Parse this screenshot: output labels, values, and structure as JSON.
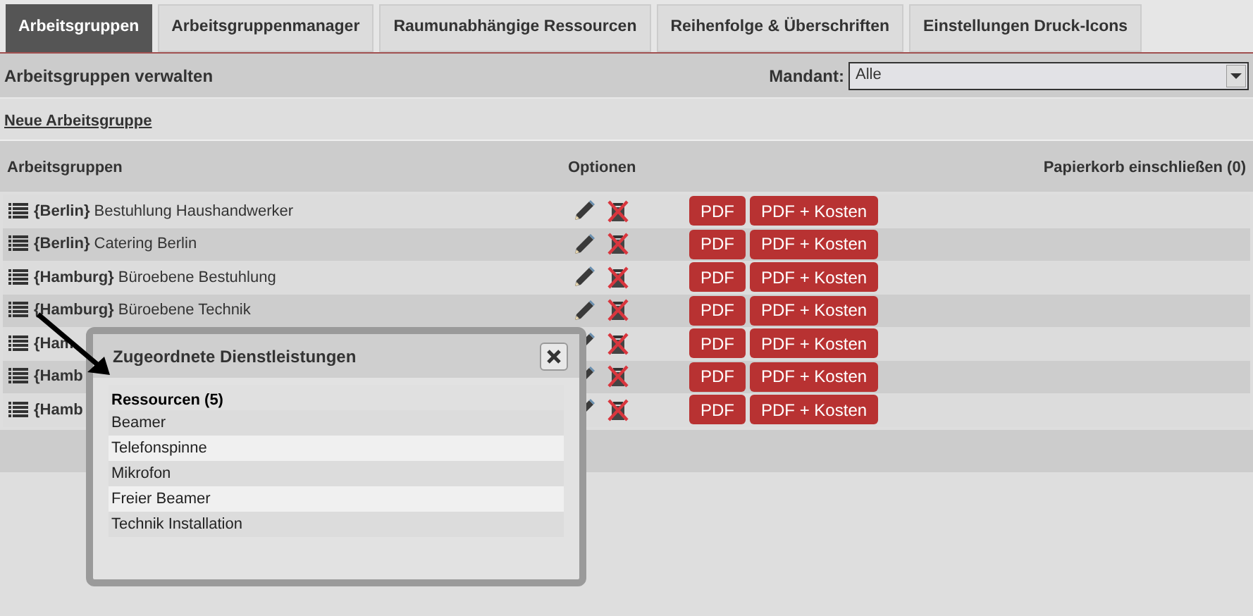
{
  "tabs": [
    {
      "label": "Arbeitsgruppen",
      "selected": true
    },
    {
      "label": "Arbeitsgruppenmanager",
      "selected": false
    },
    {
      "label": "Raumunabhängige Ressourcen",
      "selected": false
    },
    {
      "label": "Reihenfolge & Überschriften",
      "selected": false
    },
    {
      "label": "Einstellungen Druck-Icons",
      "selected": false
    }
  ],
  "section_title": "Arbeitsgruppen verwalten",
  "mandant": {
    "label": "Mandant:",
    "value": "Alle"
  },
  "new_link": "Neue Arbeitsgruppe",
  "table": {
    "columns": [
      "Arbeitsgruppen",
      "Optionen",
      "Papierkorb einschließen (0)"
    ],
    "rows": [
      {
        "location": "{Berlin}",
        "name": "Bestuhlung Haushandwerker",
        "pdf": "PDF",
        "pdf_costs": "PDF + Kosten"
      },
      {
        "location": "{Berlin}",
        "name": "Catering Berlin",
        "pdf": "PDF",
        "pdf_costs": "PDF + Kosten"
      },
      {
        "location": "{Hamburg}",
        "name": "Büroebene Bestuhlung",
        "pdf": "PDF",
        "pdf_costs": "PDF + Kosten"
      },
      {
        "location": "{Hamburg}",
        "name": "Büroebene Technik",
        "pdf": "PDF",
        "pdf_costs": "PDF + Kosten"
      },
      {
        "location": "{Ham",
        "pdf": "PDF",
        "pdf_costs": "PDF + Kosten"
      },
      {
        "location": "{Hamb",
        "pdf": "PDF",
        "pdf_costs": "PDF + Kosten"
      },
      {
        "location": "{Hamb",
        "pdf": "PDF",
        "pdf_costs": "PDF + Kosten"
      }
    ]
  },
  "popup": {
    "title": "Zugeordnete Dienstleistungen",
    "heading": "Ressourcen (5)",
    "items": [
      "Beamer",
      "Telefonspinne",
      "Mikrofon",
      "Freier Beamer",
      "Technik Installation"
    ]
  }
}
